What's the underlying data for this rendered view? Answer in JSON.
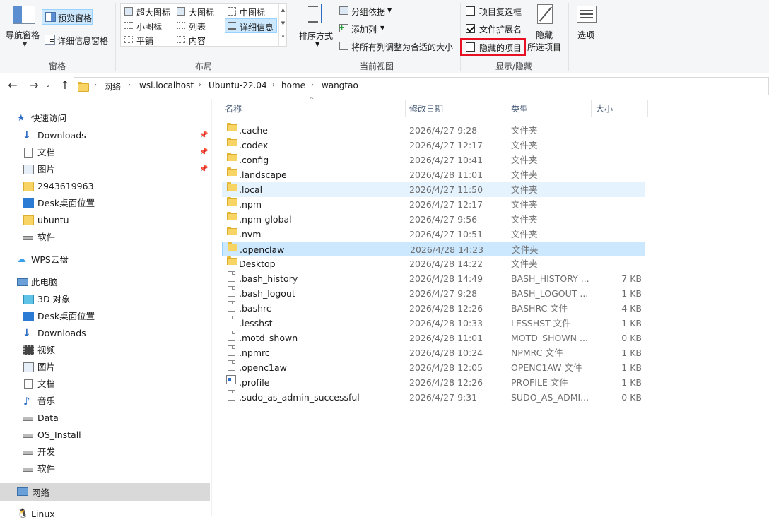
{
  "ribbon": {
    "pane": {
      "nav_pane": "导航窗格",
      "preview_pane": "预览窗格",
      "details_pane": "详细信息窗格",
      "group": "窗格"
    },
    "layout": {
      "items": [
        "超大图标",
        "大图标",
        "中图标",
        "小图标",
        "列表",
        "详细信息",
        "平铺",
        "内容"
      ],
      "selected": "详细信息",
      "group": "布局"
    },
    "current_view": {
      "sort_by": "排序方式",
      "group_by": "分组依据",
      "add_column": "添加列",
      "fit_columns": "将所有列调整为合适的大小",
      "group": "当前视图"
    },
    "show_hide": {
      "item_checkboxes": "项目复选框",
      "item_checkboxes_checked": false,
      "file_extensions": "文件扩展名",
      "file_extensions_checked": true,
      "hidden_items": "隐藏的项目",
      "hidden_items_checked": false,
      "hide_selected_line1": "隐藏",
      "hide_selected_line2": "所选项目",
      "group": "显示/隐藏"
    },
    "options": "选项"
  },
  "address": {
    "crumbs": [
      "网络",
      "wsl.localhost",
      "Ubuntu-22.04",
      "home",
      "wangtao"
    ]
  },
  "nav": {
    "quick_access": "快速访问",
    "quick_items": [
      "Downloads",
      "文档",
      "图片",
      "2943619963",
      "Desk桌面位置",
      "ubuntu",
      "软件"
    ],
    "wps": "WPS云盘",
    "this_pc": "此电脑",
    "pc_items": [
      "3D 对象",
      "Desk桌面位置",
      "Downloads",
      "视频",
      "图片",
      "文档",
      "音乐",
      "Data",
      "OS_Install",
      "开发",
      "软件"
    ],
    "network": "网络",
    "linux": "Linux"
  },
  "columns": {
    "name": "名称",
    "date": "修改日期",
    "type": "类型",
    "size": "大小"
  },
  "files": [
    {
      "name": ".cache",
      "date": "2026/4/27 9:28",
      "type": "文件夹",
      "size": "",
      "kind": "folder"
    },
    {
      "name": ".codex",
      "date": "2026/4/27 12:17",
      "type": "文件夹",
      "size": "",
      "kind": "folder"
    },
    {
      "name": ".config",
      "date": "2026/4/27 10:41",
      "type": "文件夹",
      "size": "",
      "kind": "folder"
    },
    {
      "name": ".landscape",
      "date": "2026/4/28 11:01",
      "type": "文件夹",
      "size": "",
      "kind": "folder"
    },
    {
      "name": ".local",
      "date": "2026/4/27 11:50",
      "type": "文件夹",
      "size": "",
      "kind": "folder"
    },
    {
      "name": ".npm",
      "date": "2026/4/27 12:17",
      "type": "文件夹",
      "size": "",
      "kind": "folder"
    },
    {
      "name": ".npm-global",
      "date": "2026/4/27 9:56",
      "type": "文件夹",
      "size": "",
      "kind": "folder"
    },
    {
      "name": ".nvm",
      "date": "2026/4/27 10:51",
      "type": "文件夹",
      "size": "",
      "kind": "folder"
    },
    {
      "name": ".openclaw",
      "date": "2026/4/28 14:23",
      "type": "文件夹",
      "size": "",
      "kind": "folder"
    },
    {
      "name": "Desktop",
      "date": "2026/4/28 14:22",
      "type": "文件夹",
      "size": "",
      "kind": "folder"
    },
    {
      "name": ".bash_history",
      "date": "2026/4/28 14:49",
      "type": "BASH_HISTORY ...",
      "size": "7 KB",
      "kind": "file"
    },
    {
      "name": ".bash_logout",
      "date": "2026/4/27 9:28",
      "type": "BASH_LOGOUT ...",
      "size": "1 KB",
      "kind": "file"
    },
    {
      "name": ".bashrc",
      "date": "2026/4/28 12:26",
      "type": "BASHRC 文件",
      "size": "4 KB",
      "kind": "file"
    },
    {
      "name": ".lesshst",
      "date": "2026/4/28 10:33",
      "type": "LESSHST 文件",
      "size": "1 KB",
      "kind": "file"
    },
    {
      "name": ".motd_shown",
      "date": "2026/4/28 11:01",
      "type": "MOTD_SHOWN ...",
      "size": "0 KB",
      "kind": "file"
    },
    {
      "name": ".npmrc",
      "date": "2026/4/28 10:24",
      "type": "NPMRC 文件",
      "size": "1 KB",
      "kind": "file"
    },
    {
      "name": ".openc1aw",
      "date": "2026/4/28 12:05",
      "type": "OPENC1AW 文件",
      "size": "1 KB",
      "kind": "file"
    },
    {
      "name": ".profile",
      "date": "2026/4/28 12:26",
      "type": "PROFILE 文件",
      "size": "1 KB",
      "kind": "config"
    },
    {
      "name": ".sudo_as_admin_successful",
      "date": "2026/4/27 9:31",
      "type": "SUDO_AS_ADMI...",
      "size": "0 KB",
      "kind": "file"
    }
  ],
  "hovered_file": ".local",
  "selected_file": ".openclaw",
  "colors": {
    "accent": "#0078d7",
    "highlight_box": "#e81123",
    "selection": "#cce8ff"
  }
}
